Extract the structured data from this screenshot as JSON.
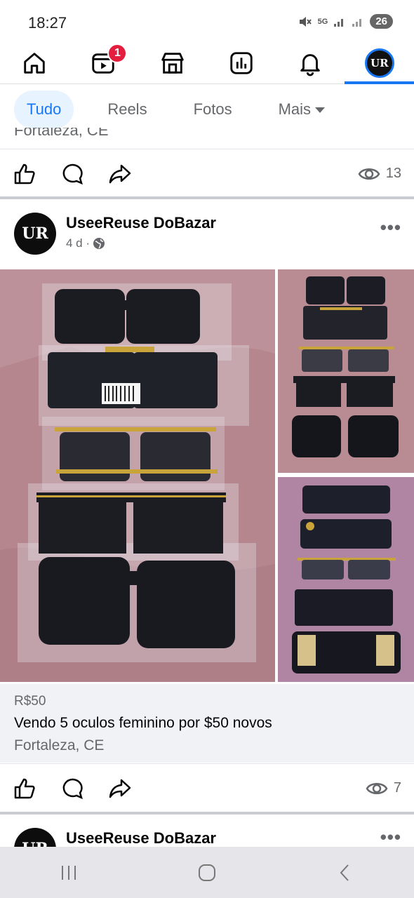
{
  "status_bar": {
    "time": "18:27",
    "network": "5G",
    "battery": "26"
  },
  "nav": {
    "items": [
      {
        "name": "home"
      },
      {
        "name": "video",
        "badge": "1"
      },
      {
        "name": "marketplace"
      },
      {
        "name": "feeds"
      },
      {
        "name": "notifications"
      },
      {
        "name": "profile",
        "avatar_text": "UR",
        "active": true
      }
    ]
  },
  "filters": {
    "items": [
      "Tudo",
      "Reels",
      "Fotos",
      "Mais"
    ],
    "active": "Tudo"
  },
  "prev_post": {
    "location_partial": "Fortaleza, CE",
    "views": "13"
  },
  "post": {
    "author": "UseeReuse DoBazar",
    "avatar_text": "UR",
    "time": "4 d ·",
    "more": "•••",
    "price": "R$50",
    "title": "Vendo 5 oculos feminino por $50 novos",
    "location": "Fortaleza, CE",
    "views": "7"
  },
  "next_post": {
    "author": "UseeReuse DoBazar",
    "avatar_text": "UR",
    "more": "•••"
  },
  "colors": {
    "accent": "#1877f2",
    "badge": "#e41e3f",
    "muted": "#65676b",
    "listing_bg": "#f0f2f5"
  }
}
